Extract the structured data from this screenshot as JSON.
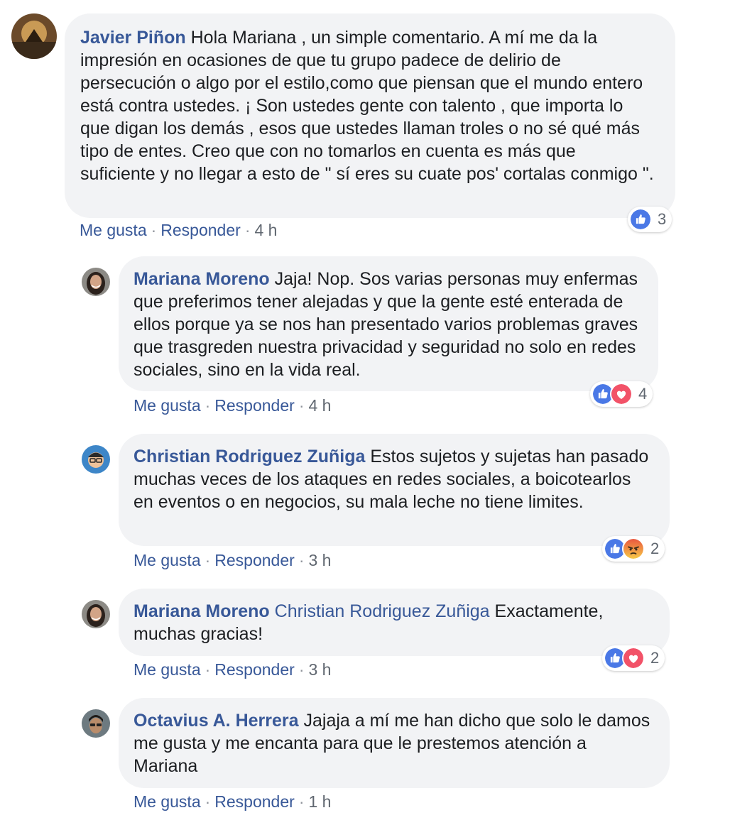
{
  "colors": {
    "bubble": "#f2f3f5",
    "author": "#385898",
    "link": "#385898",
    "like": "#3b5998",
    "love": "#f25268",
    "angry": "#f5a623"
  },
  "comments": [
    {
      "author": "Javier Piñon",
      "mention": "",
      "text": "Hola Mariana , un simple comentario. A mí me da la impresión en ocasiones de que tu grupo padece de delirio de persecución o algo por el estilo,como que piensan que el mundo entero está contra ustedes. ¡ Son ustedes gente con talento , que importa lo que digan los demás , esos que ustedes llaman troles o no sé qué más tipo de entes. Creo que con no tomarlos en cuenta es más que suficiente y no llegar a esto de \" sí eres su cuate pos' cortalas conmigo \".",
      "like_label": "Me gusta",
      "reply_label": "Responder",
      "time": "4 h",
      "reactions": [
        "like-icon"
      ],
      "reaction_count": "3"
    },
    {
      "author": "Mariana Moreno",
      "mention": "",
      "text": "Jaja! Nop. Sos varias personas muy enfermas que preferimos tener alejadas y que la gente esté enterada de ellos porque ya se nos han presentado varios problemas graves que trasgreden nuestra privacidad y seguridad no solo en redes sociales, sino en la vida real.",
      "like_label": "Me gusta",
      "reply_label": "Responder",
      "time": "4 h",
      "reactions": [
        "like-icon",
        "love-icon"
      ],
      "reaction_count": "4"
    },
    {
      "author": "Christian Rodriguez Zuñiga",
      "mention": "",
      "text": "Estos sujetos y sujetas han pasado muchas veces de los ataques en redes sociales, a boicotearlos en eventos o en negocios, su mala leche no tiene limites.",
      "like_label": "Me gusta",
      "reply_label": "Responder",
      "time": "3 h",
      "reactions": [
        "like-icon",
        "angry-icon"
      ],
      "reaction_count": "2"
    },
    {
      "author": "Mariana Moreno",
      "mention": "Christian Rodriguez Zuñiga",
      "text": "Exactamente, muchas gracias!",
      "like_label": "Me gusta",
      "reply_label": "Responder",
      "time": "3 h",
      "reactions": [
        "like-icon",
        "love-icon"
      ],
      "reaction_count": "2"
    },
    {
      "author": "Octavius A. Herrera",
      "mention": "",
      "text": "Jajaja a mí me han dicho que solo le damos me gusta y me encanta para que le prestemos atención a Mariana",
      "like_label": "Me gusta",
      "reply_label": "Responder",
      "time": "1 h",
      "reactions": [],
      "reaction_count": ""
    }
  ]
}
